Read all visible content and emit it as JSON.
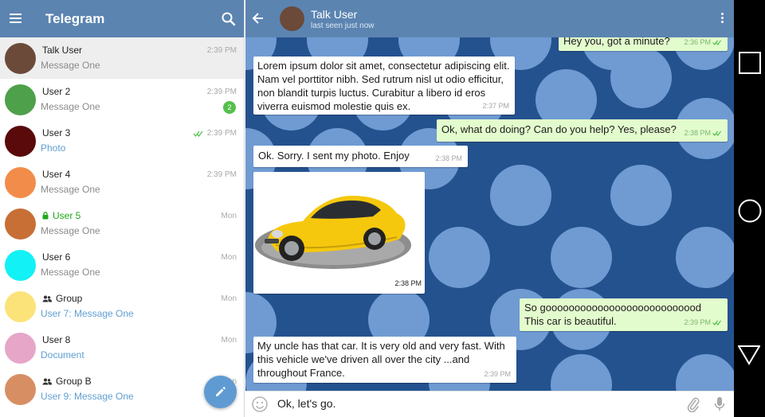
{
  "app": {
    "title": "Telegram"
  },
  "chats": [
    {
      "name": "Talk User",
      "message": "Message One",
      "time": "2:39 PM",
      "avatar_color": "#6b4a3a",
      "active": true
    },
    {
      "name": "User 2",
      "message": "Message One",
      "time": "2:39 PM",
      "avatar_color": "#4ea04a",
      "unread": "2"
    },
    {
      "name": "User 3",
      "message": "Photo",
      "time": "2:39 PM",
      "avatar_color": "#5a0a0a",
      "read_ticks": true,
      "message_style": "media"
    },
    {
      "name": "User 4",
      "message": "Message One",
      "time": "2:39 PM",
      "avatar_color": "#f28c4a"
    },
    {
      "name": "User 5",
      "message": "Message One",
      "time": "Mon",
      "avatar_color": "#c76f35",
      "secret": true
    },
    {
      "name": "User 6",
      "message": "Message One",
      "time": "Mon",
      "avatar_color": "#12f1f5"
    },
    {
      "name": "Group",
      "message": "User 7: Message One",
      "time": "Mon",
      "avatar_color": "#fbe37a",
      "group": true,
      "message_style": "sender"
    },
    {
      "name": "User 8",
      "message": "Document",
      "time": "Mon",
      "avatar_color": "#e6a6c8",
      "message_style": "media"
    },
    {
      "name": "Group B",
      "message": "User 9: Message One",
      "time": "Mon",
      "avatar_color": "#d88e63",
      "group": true,
      "message_style": "sender"
    }
  ],
  "conversation": {
    "name": "Talk User",
    "status": "last seen just now",
    "avatar_color": "#6b4a3a",
    "messages": [
      {
        "dir": "out",
        "text": "Hey you, got  a minute?",
        "time": "2:36 PM",
        "read": true
      },
      {
        "dir": "in",
        "text": "Lorem ipsum dolor sit amet, consectetur adipiscing elit. Nam vel porttitor nibh. Sed rutrum nisl ut odio efficitur, non blandit turpis luctus. Curabitur a libero id eros viverra euismod molestie quis ex.",
        "time": "2:37 PM"
      },
      {
        "dir": "out",
        "text": "Ok, what do doing? Can do you help? Yes, please?",
        "time": "2:38 PM",
        "read": true
      },
      {
        "dir": "in",
        "text": "Ok. Sorry. I sent my photo. Enjoy",
        "time": "2:38 PM"
      },
      {
        "dir": "in",
        "type": "photo",
        "description": "yellow sports car",
        "time": "2:38 PM"
      },
      {
        "dir": "out",
        "text": "So gooooooooooooooooooooooooood This car is beautiful.",
        "time": "2:39 PM",
        "read": true
      },
      {
        "dir": "in",
        "text": "My uncle has that car. It is very old and very fast. With this vehicle we've driven all over the city ...and throughout France.",
        "time": "2:39 PM"
      }
    ]
  },
  "input": {
    "value": "Ok, let's go."
  },
  "colors": {
    "header": "#5b84b1",
    "chat_background": "#24528f",
    "pattern_dots": "#6f9bd2",
    "outgoing_bubble": "#e3fccd",
    "incoming_bubble": "#ffffff",
    "fab": "#5f9bd2",
    "unread_badge": "#54c04c",
    "secret_chat": "#1ea81a"
  },
  "icons": {
    "menu": "hamburger-icon",
    "search": "search-icon",
    "back": "arrow-back-icon",
    "more": "more-vert-icon",
    "compose": "pencil-icon",
    "emoji": "smiley-icon",
    "attach": "paperclip-icon",
    "voice": "microphone-icon",
    "lock": "lock-icon",
    "group": "group-icon",
    "read": "double-check-icon",
    "nav_recents": "square-icon",
    "nav_home": "circle-icon",
    "nav_back": "triangle-icon"
  }
}
